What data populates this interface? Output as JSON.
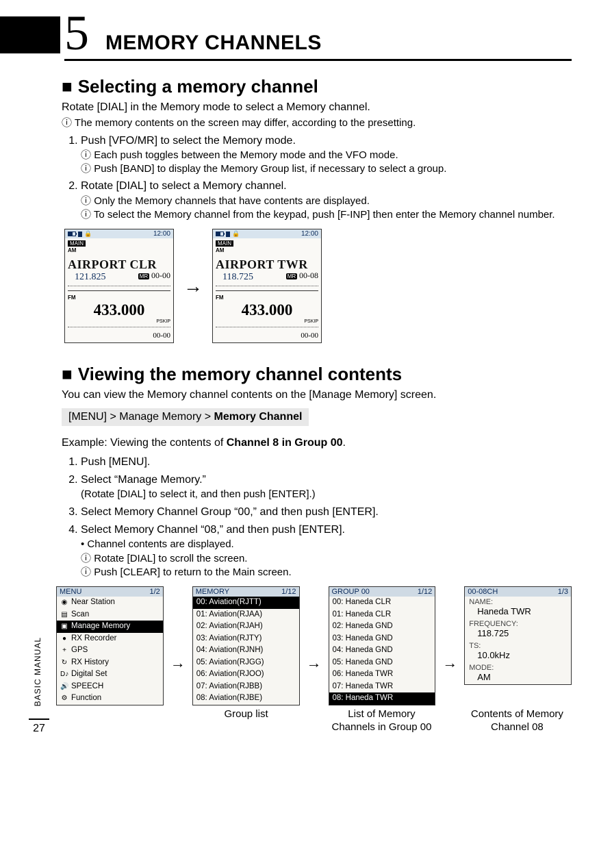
{
  "chapter": {
    "number": "5",
    "title": "MEMORY CHANNELS"
  },
  "section1": {
    "heading": "Selecting a memory channel",
    "intro": "Rotate [DIAL] in the Memory mode to select a Memory channel.",
    "intro_note": "The memory contents on the screen may differ, according to the presetting.",
    "steps": {
      "s1": "Push [VFO/MR] to select the Memory mode.",
      "s1a": "Each push toggles between the Memory mode and the VFO mode.",
      "s1b": "Push [BAND] to display the Memory Group list, if necessary to select a group.",
      "s2": "Rotate [DIAL] to select a Memory channel.",
      "s2a": "Only the Memory channels that have contents are displayed.",
      "s2b": "To select the Memory channel from the keypad, push [F-INP] then enter the Memory channel number."
    }
  },
  "lcd1": {
    "time": "12:00",
    "main": "MAIN",
    "mode_top": "AM",
    "name": "AIRPORT  CLR",
    "freq": "121.825",
    "mr_label": "MR",
    "mr_num": "00-00",
    "mode_bot": "FM",
    "freq_bot": "433.000",
    "pskip": "PSKIP",
    "bot_num": "00-00"
  },
  "lcd2": {
    "time": "12:00",
    "main": "MAIN",
    "mode_top": "AM",
    "name": "AIRPORT  TWR",
    "freq": "118.725",
    "mr_label": "MR",
    "mr_num": "00-08",
    "mode_bot": "FM",
    "freq_bot": "433.000",
    "pskip": "PSKIP",
    "bot_num": "00-00"
  },
  "section2": {
    "heading": "Viewing the memory channel contents",
    "intro": "You can view the Memory channel contents on the [Manage Memory] screen.",
    "menu_prefix": "[MENU] > Manage Memory > ",
    "menu_bold": "Memory Channel",
    "example_prefix": "Example: Viewing the contents of ",
    "example_bold": "Channel 8 in Group 00",
    "steps": {
      "s1": "Push [MENU].",
      "s2": "Select “Manage Memory.”",
      "s2_sub": "(Rotate [DIAL] to select it, and then push [ENTER].)",
      "s3": "Select Memory Channel Group “00,” and then push [ENTER].",
      "s4": "Select Memory Channel “08,” and then push [ENTER].",
      "s4_bullet": "Channel contents are displayed.",
      "s4a": "Rotate [DIAL] to scroll the screen.",
      "s4b": "Push [CLEAR] to return to the Main screen."
    }
  },
  "menu_screen": {
    "title": "MENU",
    "page": "1/2",
    "items": [
      {
        "icon": "◉",
        "label": "Near Station"
      },
      {
        "icon": "▤",
        "label": "Scan"
      },
      {
        "icon": "▣",
        "label": "Manage Memory",
        "selected": true
      },
      {
        "icon": "●",
        "label": "RX Recorder"
      },
      {
        "icon": "+",
        "label": "GPS"
      },
      {
        "icon": "↻",
        "label": "RX History"
      },
      {
        "icon": "D♪",
        "label": "Digital Set"
      },
      {
        "icon": "🔊",
        "label": "SPEECH"
      },
      {
        "icon": "⚙",
        "label": "Function"
      }
    ]
  },
  "memory_screen": {
    "title": "MEMORY",
    "page": "1/12",
    "items": [
      {
        "label": "00: Aviation(RJTT)",
        "selected": true
      },
      {
        "label": "01: Aviation(RJAA)"
      },
      {
        "label": "02: Aviation(RJAH)"
      },
      {
        "label": "03: Aviation(RJTY)"
      },
      {
        "label": "04: Aviation(RJNH)"
      },
      {
        "label": "05: Aviation(RJGG)"
      },
      {
        "label": "06: Aviation(RJOO)"
      },
      {
        "label": "07: Aviation(RJBB)"
      },
      {
        "label": "08: Aviation(RJBE)"
      }
    ]
  },
  "group_screen": {
    "title": "GROUP 00",
    "page": "1/12",
    "items": [
      {
        "label": "00: Haneda CLR"
      },
      {
        "label": "01: Haneda CLR"
      },
      {
        "label": "02: Haneda GND"
      },
      {
        "label": "03: Haneda GND"
      },
      {
        "label": "04: Haneda GND"
      },
      {
        "label": "05: Haneda GND"
      },
      {
        "label": "06: Haneda TWR"
      },
      {
        "label": "07: Haneda TWR"
      },
      {
        "label": "08: Haneda TWR",
        "selected": true
      }
    ]
  },
  "detail_screen": {
    "title": "00-08CH",
    "page": "1/3",
    "name_label": "NAME:",
    "name_val": "Haneda TWR",
    "freq_label": "FREQUENCY:",
    "freq_val": "118.725",
    "ts_label": "TS:",
    "ts_val": "10.0kHz",
    "mode_label": "MODE:",
    "mode_val": "AM"
  },
  "captions": {
    "c2": "Group list",
    "c3": "List of Memory Channels in Group 00",
    "c4": "Contents of Memory Channel 08"
  },
  "sidebar_text": "BASIC MANUAL",
  "page_number": "27"
}
